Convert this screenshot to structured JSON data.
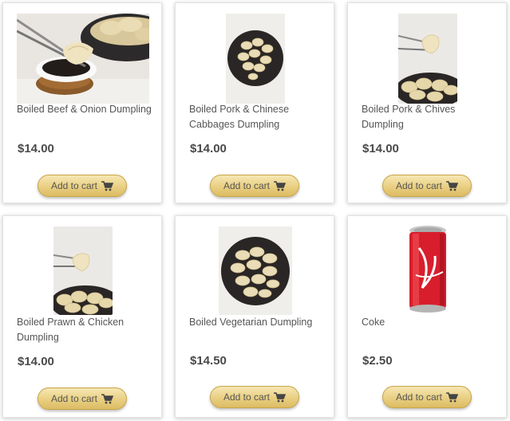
{
  "products": [
    {
      "name": "Boiled Beef & Onion Dumpling",
      "price": "$14.00",
      "add_label": "Add to cart",
      "image_icon": "dumpling-dipping-sauce-photo"
    },
    {
      "name": "Boiled Pork & Chinese Cabbages Dumpling",
      "price": "$14.00",
      "add_label": "Add to cart",
      "image_icon": "dumpling-plate-photo"
    },
    {
      "name": "Boiled Pork & Chives Dumpling",
      "price": "$14.00",
      "add_label": "Add to cart",
      "image_icon": "dumpling-chopsticks-photo"
    },
    {
      "name": "Boiled Prawn & Chicken Dumpling",
      "price": "$14.00",
      "add_label": "Add to cart",
      "image_icon": "dumpling-chopsticks-photo"
    },
    {
      "name": "Boiled Vegetarian Dumpling",
      "price": "$14.50",
      "add_label": "Add to cart",
      "image_icon": "dumpling-plate-photo"
    },
    {
      "name": "Coke",
      "price": "$2.50",
      "add_label": "Add to cart",
      "image_icon": "coke-can-photo"
    }
  ],
  "colors": {
    "button_gold_top": "#f6e7b3",
    "button_gold_bottom": "#dcbc63",
    "coke_red": "#d81e2c",
    "plate_black": "#2a2626"
  },
  "icons": {
    "cart": "shopping-cart-icon"
  }
}
